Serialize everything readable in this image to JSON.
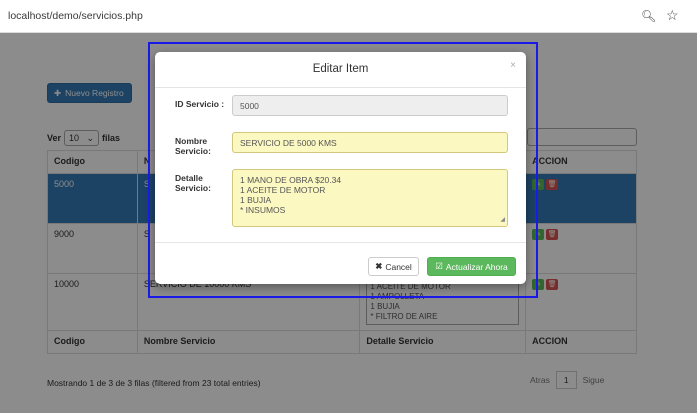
{
  "browser": {
    "url": "localhost/demo/servicios.php",
    "zoom_icon": "zoom-icon",
    "star_icon": "star-icon"
  },
  "page": {
    "new_button": "Nuevo Registro",
    "length": {
      "prefix": "Ver",
      "value": "10",
      "suffix": "filas"
    },
    "table": {
      "headers": [
        "Codigo",
        "Nombre Servicio",
        "Detalle Servicio",
        "ACCION"
      ],
      "header_visible": [
        "Codigo",
        "N",
        "",
        "ACCION"
      ],
      "rows": [
        {
          "codigo": "5000",
          "nombre_partial": "S"
        },
        {
          "codigo": "9000",
          "nombre_partial": "S"
        },
        {
          "codigo": "10000",
          "nombre": "SERVICIO DE 10000 KMS",
          "detalle": [
            "1 ACEITE DE MOTOR",
            "1 AMPOLLETA",
            "1 BUJIA",
            "* FILTRO DE AIRE"
          ]
        }
      ],
      "footer": [
        "Codigo",
        "Nombre Servicio",
        "Detalle Servicio",
        "ACCION"
      ]
    },
    "info": "Mostrando 1 de 3 de 3 filas (filtered from 23 total entries)",
    "pager": {
      "prev": "Atras",
      "current": "1",
      "next": "Sigue"
    }
  },
  "modal": {
    "title": "Editar Item",
    "close": "×",
    "id_label": "ID Servicio :",
    "id_value": "5000",
    "name_label": "Nombre Servicio:",
    "name_value": "SERVICIO DE 5000 KMS",
    "detail_label": "Detalle Servicio:",
    "detail_lines": [
      "1 MANO DE OBRA $20.34",
      "1 ACEITE DE MOTOR",
      "1 BUJIA",
      "* INSUMOS"
    ],
    "cancel_label": "Cancel",
    "update_label": "Actualizar Ahora"
  },
  "colors": {
    "primary": "#337ab7",
    "success": "#5cb85c",
    "danger": "#d9534f",
    "highlight_field": "#fbf8c2",
    "focus_outline": "#1a1ae6"
  }
}
